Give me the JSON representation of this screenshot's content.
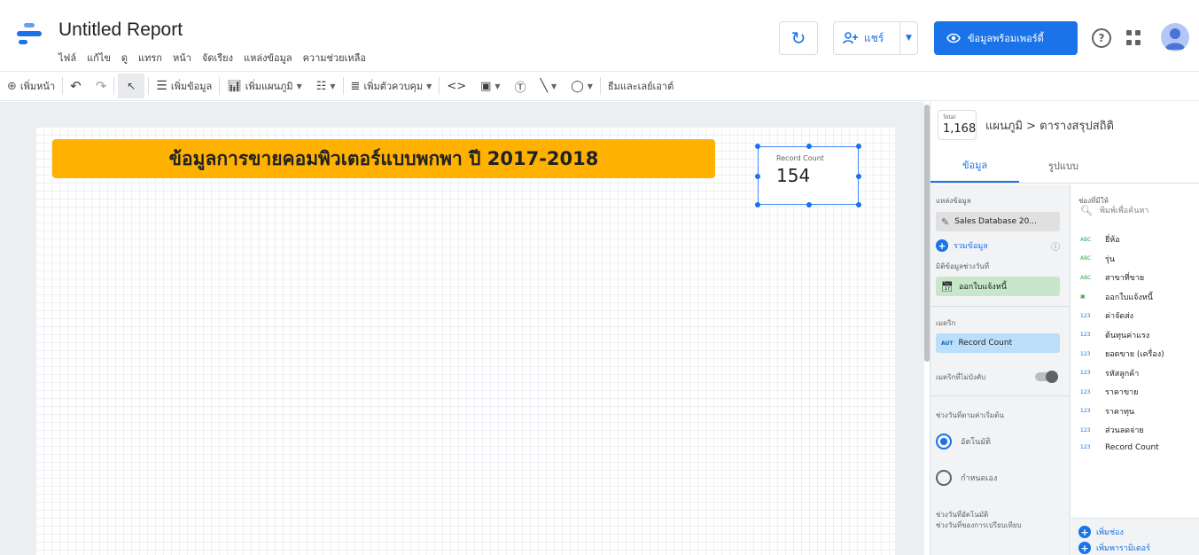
{
  "header": {
    "title": "Untitled Report",
    "menu": [
      "ไฟล์",
      "แก้ไข",
      "ดู",
      "แทรก",
      "หน้า",
      "จัดเรียง",
      "แหล่งข้อมูล",
      "ความช่วยเหลือ"
    ],
    "share_label": "แชร์",
    "view_label": "ข้อมูลพร้อมเพอร์ดี้",
    "accent_color": "#1a73e8"
  },
  "toolbar": {
    "add_page": "เพิ่มหน้า",
    "add_data": "เพิ่มข้อมูล",
    "add_chart": "เพิ่มแผนภูมิ",
    "add_control": "เพิ่มตัวควบคุม",
    "theme_layout": "ธีมและเลย์เอาต์"
  },
  "canvas": {
    "banner_title": "ข้อมูลการขายคอมพิวเตอร์แบบพกพา ปี 2017-2018",
    "banner_color": "#ffb100",
    "scorecard": {
      "label": "Record Count",
      "value": "154"
    }
  },
  "panel": {
    "badge_total_label": "Total",
    "badge_total_value": "1,168",
    "breadcrumb": "แผนภูมิ > ตารางสรุปสถิติ",
    "tabs": [
      "ข้อมูล",
      "รูปแบบ"
    ],
    "left": {
      "datasource_label": "แหล่งข้อมูล",
      "datasource_value": "Sales Database 20...",
      "blend_label": "รวมข้อมูล",
      "date_dim_label": "มิติข้อมูลช่วงวันที่",
      "date_dim_value": "ออกใบแจ้งหนี้",
      "metric_label": "เมตริก",
      "metric_value": "Record Count",
      "metric_badge": "AUT",
      "optional_metric_label": "เมตริกที่ไม่บังคับ",
      "default_range_label": "ช่วงวันที่ตามค่าเริ่มต้น",
      "auto_label": "อัตโนมัติ",
      "custom_label": "กำหนดเอง",
      "compare_label1": "ช่วงวันที่อัตโนมัติ",
      "compare_label2": "ช่วงวันที่ของการเปรียบเทียบ"
    },
    "right": {
      "available_label": "ช่องที่มีให้",
      "search_placeholder": "พิมพ์เพื่อค้นหา",
      "fields": [
        {
          "type": "ABC",
          "name": "ยี่ห้อ"
        },
        {
          "type": "ABC",
          "name": "รุ่น"
        },
        {
          "type": "ABC",
          "name": "สาขาที่ขาย"
        },
        {
          "type": "date",
          "name": "ออกใบแจ้งหนี้"
        },
        {
          "type": "123",
          "name": "ค่าจัดส่ง"
        },
        {
          "type": "123",
          "name": "ต้นทุนค่าแรง"
        },
        {
          "type": "123",
          "name": "ยอดขาย (เครื่อง)"
        },
        {
          "type": "123",
          "name": "รหัสลูกค้า"
        },
        {
          "type": "123",
          "name": "ราคาขาย"
        },
        {
          "type": "123",
          "name": "ราคาทุน"
        },
        {
          "type": "123",
          "name": "ส่วนลดจ่าย"
        },
        {
          "type": "123",
          "name": "Record Count"
        }
      ],
      "add_field": "เพิ่มช่อง",
      "add_param": "เพิ่มพารามิเตอร์"
    }
  }
}
